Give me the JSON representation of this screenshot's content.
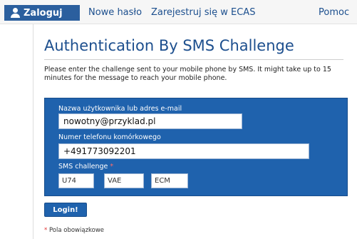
{
  "nav": {
    "login_label": "Zaloguj",
    "items": [
      {
        "label": "Nowe hasło"
      },
      {
        "label": "Zarejestruj się w ECAS"
      },
      {
        "label": "Pomoc"
      }
    ]
  },
  "page": {
    "title": "Authentication By SMS Challenge",
    "instructions": "Please enter the challenge sent to your mobile phone by SMS. It might take up to 15 minutes for the message to reach your mobile phone."
  },
  "form": {
    "username_label": "Nazwa użytkownika lub adres e-mail",
    "username_value": "nowotny@przyklad.pl",
    "phone_label": "Numer telefonu komórkowego",
    "phone_value": "+491773092201",
    "sms_label": "SMS challenge",
    "required_marker": "*",
    "sms_parts": [
      "U74",
      "VAE",
      "ECM"
    ],
    "submit_label": "Login!"
  },
  "footer": {
    "required_marker": "*",
    "required_note": "Pola obowiązkowe"
  },
  "colors": {
    "brand_blue": "#1f62ad",
    "nav_active": "#2b5f9e",
    "link_blue": "#1c4f8e"
  }
}
